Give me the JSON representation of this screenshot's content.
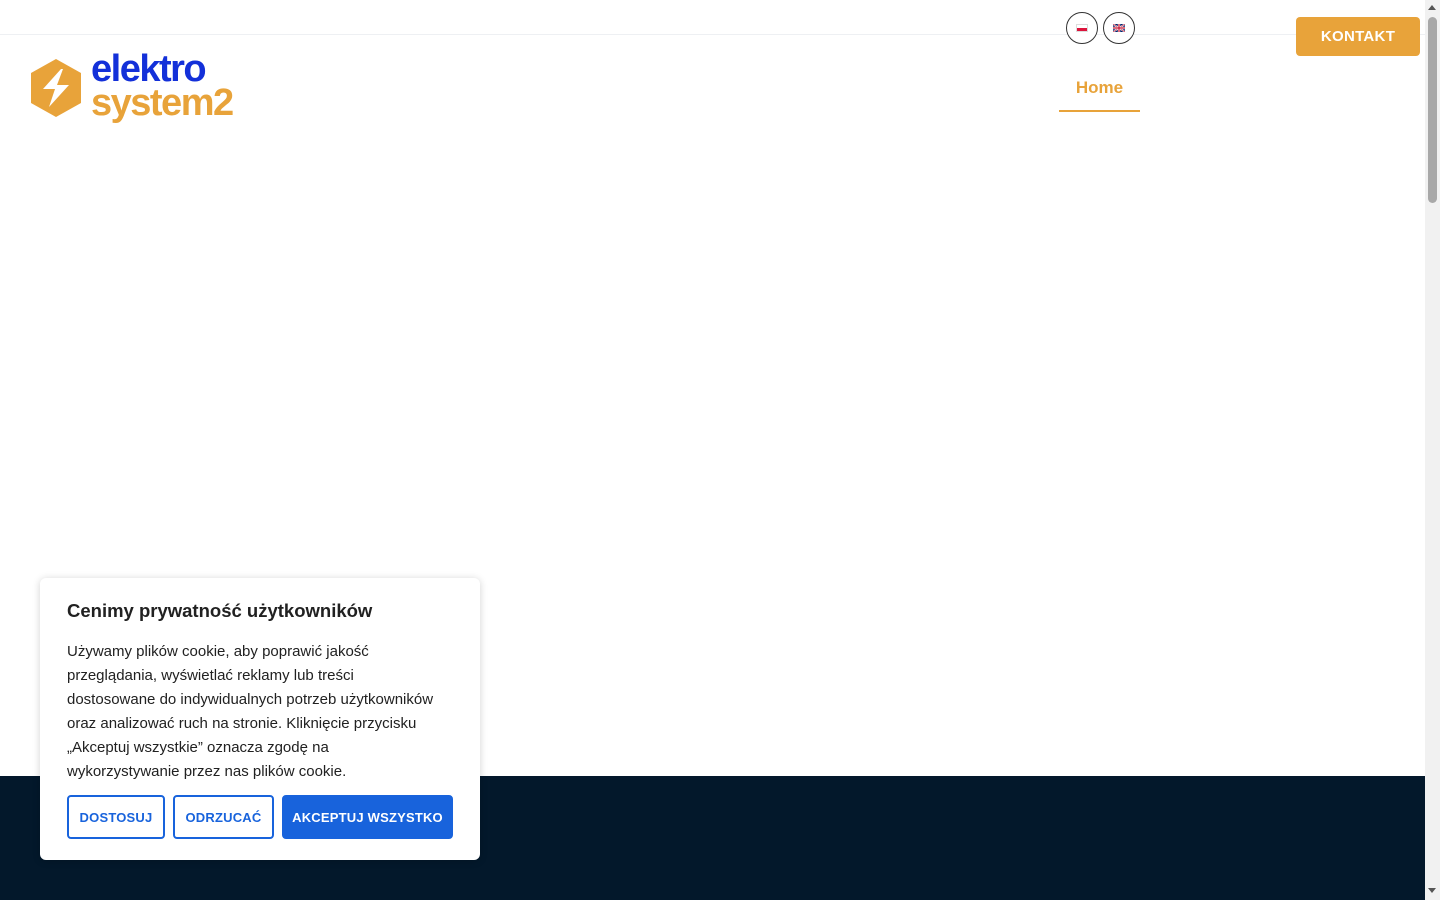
{
  "header": {
    "logo": {
      "line1": "elektro",
      "line2": "system2"
    },
    "languages": [
      {
        "code": "pl",
        "icon": "poland-flag-icon"
      },
      {
        "code": "en",
        "icon": "uk-flag-icon"
      }
    ],
    "contact_label": "KONTAKT",
    "nav": {
      "home_label": "Home"
    }
  },
  "cookie_banner": {
    "title": "Cenimy prywatność użytkowników",
    "text": "Używamy plików cookie, aby poprawić jakość przeglądania, wyświetlać reklamy lub treści dostosowane do indywidualnych potrzeb użytkowników oraz analizować ruch na stronie. Kliknięcie przycisku „Akceptuj wszystkie” oznacza zgodę na wykorzystywanie przez nas plików cookie.",
    "buttons": {
      "customize": "DOSTOSUJ",
      "reject": "ODRZUCAĆ",
      "accept_all": "AKCEPTUJ WSZYSTKO"
    }
  },
  "colors": {
    "brand_orange": "#e8a33a",
    "brand_blue": "#1330d9",
    "cookie_blue": "#1863dc",
    "footer_dark": "#03182b"
  }
}
